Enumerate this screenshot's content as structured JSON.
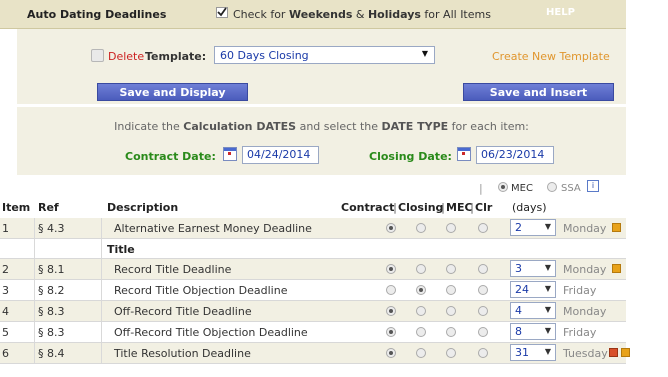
{
  "header": {
    "title": "Auto Dating Deadlines",
    "check_text_pre": "Check for ",
    "weekends": "Weekends",
    "amp": " & ",
    "holidays": "Holidays",
    "check_text_post": " for All Items",
    "help": "HELP"
  },
  "template": {
    "delete_label": "Delete",
    "template_label": "Template:",
    "selected": "60 Days Closing",
    "create_link": "Create New Template",
    "save_display": "Save and Display",
    "save_insert": "Save and Insert"
  },
  "dates": {
    "instr_1": "Indicate the ",
    "calc": "Calculation DATES",
    "instr_2": " and select the ",
    "date_type": "DATE TYPE",
    "instr_3": " for each item:",
    "contract_label": "Contract Date:",
    "contract_value": "04/24/2014",
    "closing_label": "Closing Date:",
    "closing_value": "06/23/2014"
  },
  "mode": {
    "mec": "MEC",
    "ssa": "SSA",
    "info": "i",
    "mec_selected": true
  },
  "table": {
    "headers": {
      "item": "Item",
      "ref": "Ref",
      "desc": "Description",
      "contract": "Contract",
      "closing": "Closing",
      "mec": "MEC",
      "clr": "Clr",
      "days": "(days)"
    },
    "section_title": "Title",
    "rows": [
      {
        "item": "1",
        "ref": "§ 4.3",
        "desc": "Alternative Earnest Money Deadline",
        "sel": "contract",
        "days": "2",
        "dow": "Monday",
        "icons": [
          "orange"
        ]
      },
      {
        "item": "2",
        "ref": "§ 8.1",
        "desc": "Record Title Deadline",
        "sel": "contract",
        "days": "3",
        "dow": "Monday",
        "icons": [
          "orange"
        ]
      },
      {
        "item": "3",
        "ref": "§ 8.2",
        "desc": "Record Title Objection Deadline",
        "sel": "closing",
        "days": "24",
        "dow": "Friday",
        "icons": []
      },
      {
        "item": "4",
        "ref": "§ 8.3",
        "desc": "Off-Record Title Deadline",
        "sel": "contract",
        "days": "4",
        "dow": "Monday",
        "icons": []
      },
      {
        "item": "5",
        "ref": "§ 8.3",
        "desc": "Off-Record Title Objection Deadline",
        "sel": "contract",
        "days": "8",
        "dow": "Friday",
        "icons": []
      },
      {
        "item": "6",
        "ref": "§ 8.4",
        "desc": "Title Resolution Deadline",
        "sel": "contract",
        "days": "31",
        "dow": "Tuesday",
        "icons": [
          "red",
          "orange"
        ]
      }
    ]
  },
  "colors": {
    "accent_blue": "#4b5cbc",
    "green_label": "#2a8a1a",
    "delete_red": "#cc2222",
    "create_orange": "#e0962e",
    "panel_bg": "#f2f0e3"
  }
}
